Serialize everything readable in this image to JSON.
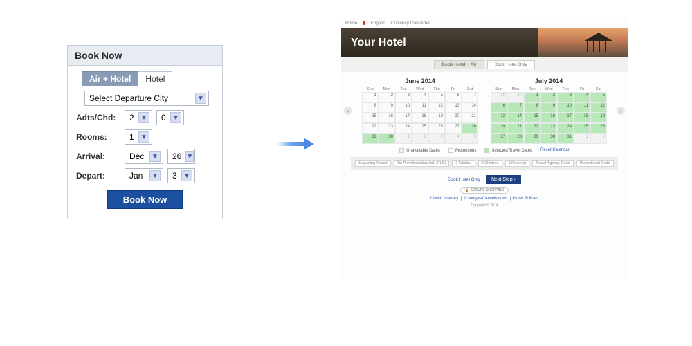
{
  "widget": {
    "title": "Book Now",
    "tabs": {
      "air_hotel": "Air + Hotel",
      "hotel": "Hotel"
    },
    "departure_placeholder": "Select Departure City",
    "labels": {
      "adts_chd": "Adts/Chd:",
      "rooms": "Rooms:",
      "arrival": "Arrival:",
      "depart": "Depart:"
    },
    "values": {
      "adults": "2",
      "children": "0",
      "rooms": "1",
      "arrival_month": "Dec",
      "arrival_day": "26",
      "depart_month": "Jan",
      "depart_day": "3"
    },
    "button": "Book Now"
  },
  "page": {
    "crumbs": [
      "Home",
      "English",
      "Currency Converter"
    ],
    "banner_title": "Your Hotel",
    "subtabs": {
      "active": "Book Hotel + Air",
      "other": "Book Hotel Only"
    },
    "calendars": [
      {
        "title": "June 2014",
        "weeks": [
          [
            {
              "d": "1"
            },
            {
              "d": "2"
            },
            {
              "d": "3"
            },
            {
              "d": "4"
            },
            {
              "d": "5"
            },
            {
              "d": "6"
            },
            {
              "d": "7"
            }
          ],
          [
            {
              "d": "8"
            },
            {
              "d": "9"
            },
            {
              "d": "10"
            },
            {
              "d": "11"
            },
            {
              "d": "12"
            },
            {
              "d": "13"
            },
            {
              "d": "14"
            }
          ],
          [
            {
              "d": "15"
            },
            {
              "d": "16"
            },
            {
              "d": "17"
            },
            {
              "d": "18"
            },
            {
              "d": "19"
            },
            {
              "d": "20"
            },
            {
              "d": "21"
            }
          ],
          [
            {
              "d": "22"
            },
            {
              "d": "23"
            },
            {
              "d": "24"
            },
            {
              "d": "25"
            },
            {
              "d": "26"
            },
            {
              "d": "27"
            },
            {
              "d": "28",
              "c": "avail"
            }
          ],
          [
            {
              "d": "29",
              "c": "avail"
            },
            {
              "d": "30",
              "c": "avail"
            },
            {
              "d": "1",
              "c": "oth"
            },
            {
              "d": "2",
              "c": "oth"
            },
            {
              "d": "3",
              "c": "oth"
            },
            {
              "d": "4",
              "c": "oth"
            },
            {
              "d": "5",
              "c": "oth"
            }
          ]
        ]
      },
      {
        "title": "July 2014",
        "weeks": [
          [
            {
              "d": "29",
              "c": "oth"
            },
            {
              "d": "30",
              "c": "oth"
            },
            {
              "d": "1",
              "c": "avail"
            },
            {
              "d": "2",
              "c": "avail"
            },
            {
              "d": "3",
              "c": "avail"
            },
            {
              "d": "4",
              "c": "avail"
            },
            {
              "d": "5",
              "c": "avail"
            }
          ],
          [
            {
              "d": "6",
              "c": "avail"
            },
            {
              "d": "7",
              "c": "avail"
            },
            {
              "d": "8",
              "c": "avail"
            },
            {
              "d": "9",
              "c": "avail"
            },
            {
              "d": "10",
              "c": "avail"
            },
            {
              "d": "11",
              "c": "avail"
            },
            {
              "d": "12",
              "c": "avail"
            }
          ],
          [
            {
              "d": "13",
              "c": "avail"
            },
            {
              "d": "14",
              "c": "avail"
            },
            {
              "d": "15",
              "c": "avail"
            },
            {
              "d": "16",
              "c": "avail"
            },
            {
              "d": "17",
              "c": "avail"
            },
            {
              "d": "18",
              "c": "avail"
            },
            {
              "d": "19",
              "c": "avail"
            }
          ],
          [
            {
              "d": "20",
              "c": "avail"
            },
            {
              "d": "21",
              "c": "avail"
            },
            {
              "d": "22",
              "c": "avail"
            },
            {
              "d": "23",
              "c": "avail"
            },
            {
              "d": "24",
              "c": "avail"
            },
            {
              "d": "25",
              "c": "avail"
            },
            {
              "d": "26",
              "c": "avail"
            }
          ],
          [
            {
              "d": "27",
              "c": "avail"
            },
            {
              "d": "28",
              "c": "avail"
            },
            {
              "d": "29",
              "c": "avail"
            },
            {
              "d": "30",
              "c": "avail"
            },
            {
              "d": "31",
              "c": "avail"
            },
            {
              "d": "1",
              "c": "oth"
            },
            {
              "d": "2",
              "c": "oth"
            }
          ]
        ]
      }
    ],
    "day_headers": [
      "Sun",
      "Mon",
      "Tue",
      "Wed",
      "Thu",
      "Fri",
      "Sat"
    ],
    "legend": {
      "unavailable": "Unavailable Dates",
      "promotions": "Promotions",
      "selected": "Selected Travel Dates",
      "reset": "Reset Calendar"
    },
    "filters": {
      "departing": "Departing Airport",
      "airport": "To: Providenciales Intl. (PLS)",
      "adults": "2 Adult(s)",
      "children": "0 Children",
      "rooms": "1 Room(s)",
      "agency": "Travel Agency Code",
      "promo": "Promotional Code"
    },
    "next": {
      "bho": "Book Hotel Only",
      "btn": "Next Step ›"
    },
    "secure": "SECURE SHOPPING",
    "links": [
      "Check Itinerary",
      "Changes/Cancellations",
      "Hotel Policies"
    ],
    "copyright": "Copyright © 2014"
  }
}
